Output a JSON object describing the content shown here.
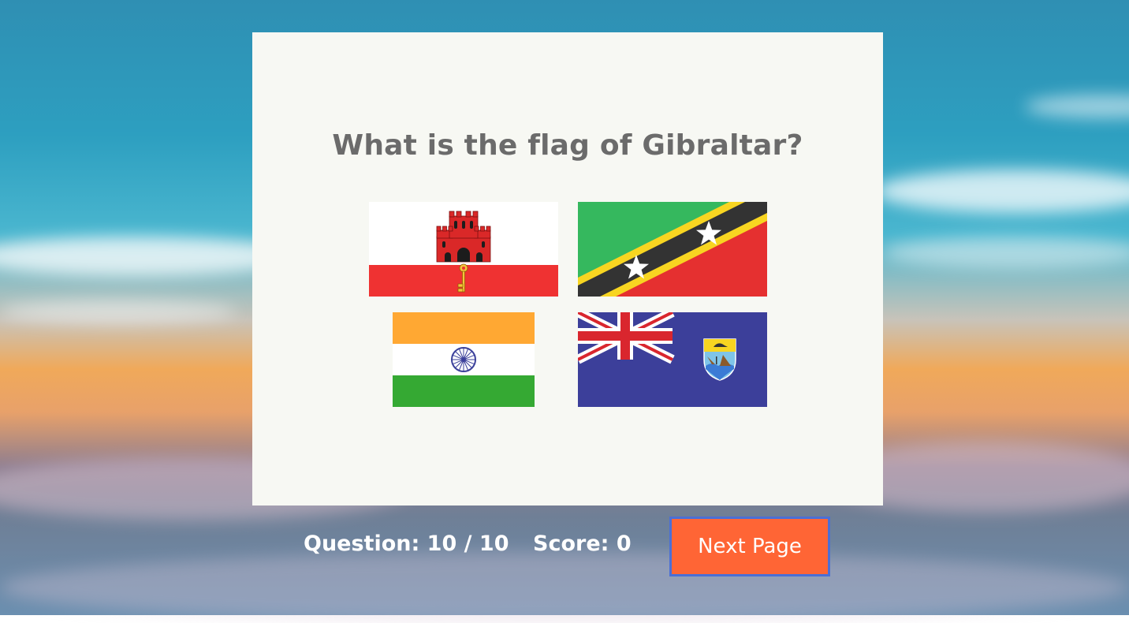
{
  "quiz": {
    "question": "What is the flag of Gibraltar?",
    "options": [
      {
        "flag": "gibraltar-flag"
      },
      {
        "flag": "saint-kitts-and-nevis-flag"
      },
      {
        "flag": "india-flag"
      },
      {
        "flag": "saint-helena-flag"
      }
    ]
  },
  "footer": {
    "question_counter": "Question: 10 / 10",
    "score": "Score: 0",
    "next_label": "Next Page"
  },
  "colors": {
    "card_background": "#f7f8f3",
    "question_text": "#6b6b6b",
    "next_button": "#ff6535",
    "next_button_border": "#4a6fd7"
  }
}
